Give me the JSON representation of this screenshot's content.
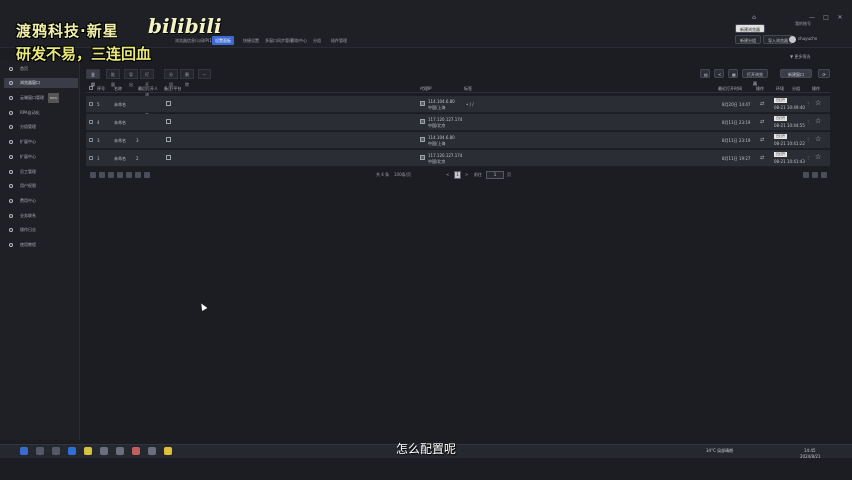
{
  "watermark": {
    "line1": "渡鸦科技·新星",
    "line2": "研发不易，三连回血",
    "logo": "bilibili"
  },
  "topbar": {
    "tabs": [
      {
        "label": "浏览器信息/公网IP(1000)",
        "active": false
      },
      {
        "label": "设置面板",
        "active": true
      },
      {
        "label": "快捷设置",
        "active": false
      },
      {
        "label": "多窗口同步管理",
        "active": false
      },
      {
        "label": "帮助中心",
        "active": false
      },
      {
        "label": "分组",
        "active": false
      },
      {
        "label": "插件管理",
        "active": false
      }
    ],
    "right_buttons": [
      "新建分组",
      "导入浏览器",
      "新建浏览器"
    ],
    "user": "shuyuchn",
    "account_label": "我的账号",
    "extra_label": "▼ 更多筛选",
    "controls": {
      "minimize": "—",
      "maximize": "□",
      "close": "✕"
    }
  },
  "sidebar": {
    "items": [
      {
        "label": "首页",
        "active": false,
        "badge": ""
      },
      {
        "label": "浏览器窗口",
        "active": true,
        "badge": ""
      },
      {
        "label": "云端窗口管理",
        "active": false,
        "badge": "NEW"
      },
      {
        "label": "RPA自动化",
        "active": false,
        "badge": ""
      },
      {
        "label": "分组管理",
        "active": false,
        "badge": ""
      },
      {
        "label": "扩展中心",
        "active": false,
        "badge": ""
      },
      {
        "label": "扩展中心",
        "active": false,
        "badge": ""
      },
      {
        "label": "员工管理",
        "active": false,
        "badge": ""
      },
      {
        "label": "用户权限",
        "active": false,
        "badge": ""
      },
      {
        "label": "费用中心",
        "active": false,
        "badge": ""
      },
      {
        "label": "业务联系",
        "active": false,
        "badge": ""
      },
      {
        "label": "操作日志",
        "active": false,
        "badge": ""
      },
      {
        "label": "使用教程",
        "active": false,
        "badge": ""
      }
    ]
  },
  "content_tabs": [
    {
      "label": "全部",
      "active": true
    },
    {
      "label": "批量",
      "active": false
    },
    {
      "label": "导出",
      "active": false
    },
    {
      "label": "打开浏览器",
      "active": false
    },
    {
      "label": "分组",
      "active": false
    },
    {
      "label": "删除",
      "active": false
    }
  ],
  "content_tools": [
    "▤",
    "<",
    "▦",
    "打开浏览器",
    "新建窗口",
    "⟳"
  ],
  "table": {
    "headers": [
      "序号",
      "名称",
      "最后打开人",
      "备注/平台",
      "代理IP",
      "标签",
      "最近打开时间",
      "操作",
      "环境",
      "分组",
      "操作"
    ],
    "rows": [
      {
        "index": "1",
        "seq": "5",
        "name": "未命名",
        "extra": "",
        "ip": "114.104.6.80",
        "ip_sub": "中国/上海",
        "tag_col": "• / /",
        "time": "8月20日 14:47",
        "status": "已打开",
        "status_time": "08-21 10:49:40"
      },
      {
        "index": "2",
        "seq": "4",
        "name": "未命名",
        "extra": "",
        "ip": "117.120.127.174",
        "ip_sub": "中国/北京",
        "tag_col": "",
        "time": "8月11日 23:19",
        "status": "已打开",
        "status_time": "08-21 10:44:55"
      },
      {
        "index": "3",
        "seq": "3",
        "name": "未命名",
        "extra": "3",
        "ip": "114.104.6.80",
        "ip_sub": "中国/上海",
        "tag_col": "",
        "time": "8月11日 23:19",
        "status": "已打开",
        "status_time": "08-21 10:41:22"
      },
      {
        "index": "4",
        "seq": "1",
        "name": "未命名",
        "extra": "2",
        "ip": "117.120.127.174",
        "ip_sub": "中国/北京",
        "tag_col": "",
        "time": "8月11日 19:27",
        "status": "已打开",
        "status_time": "08-21 10:41:43"
      }
    ]
  },
  "pagination": {
    "summary": "共 4 条",
    "per_page": "100条/页",
    "prev": "<",
    "current": "1",
    "next": ">",
    "goto_label": "前往",
    "goto_value": "1",
    "page_unit": "页"
  },
  "subtitle": "怎么配置呢",
  "taskbar": {
    "weather": "34°C 局部晴朗",
    "time": "14:45",
    "date": "2024/8/21"
  }
}
